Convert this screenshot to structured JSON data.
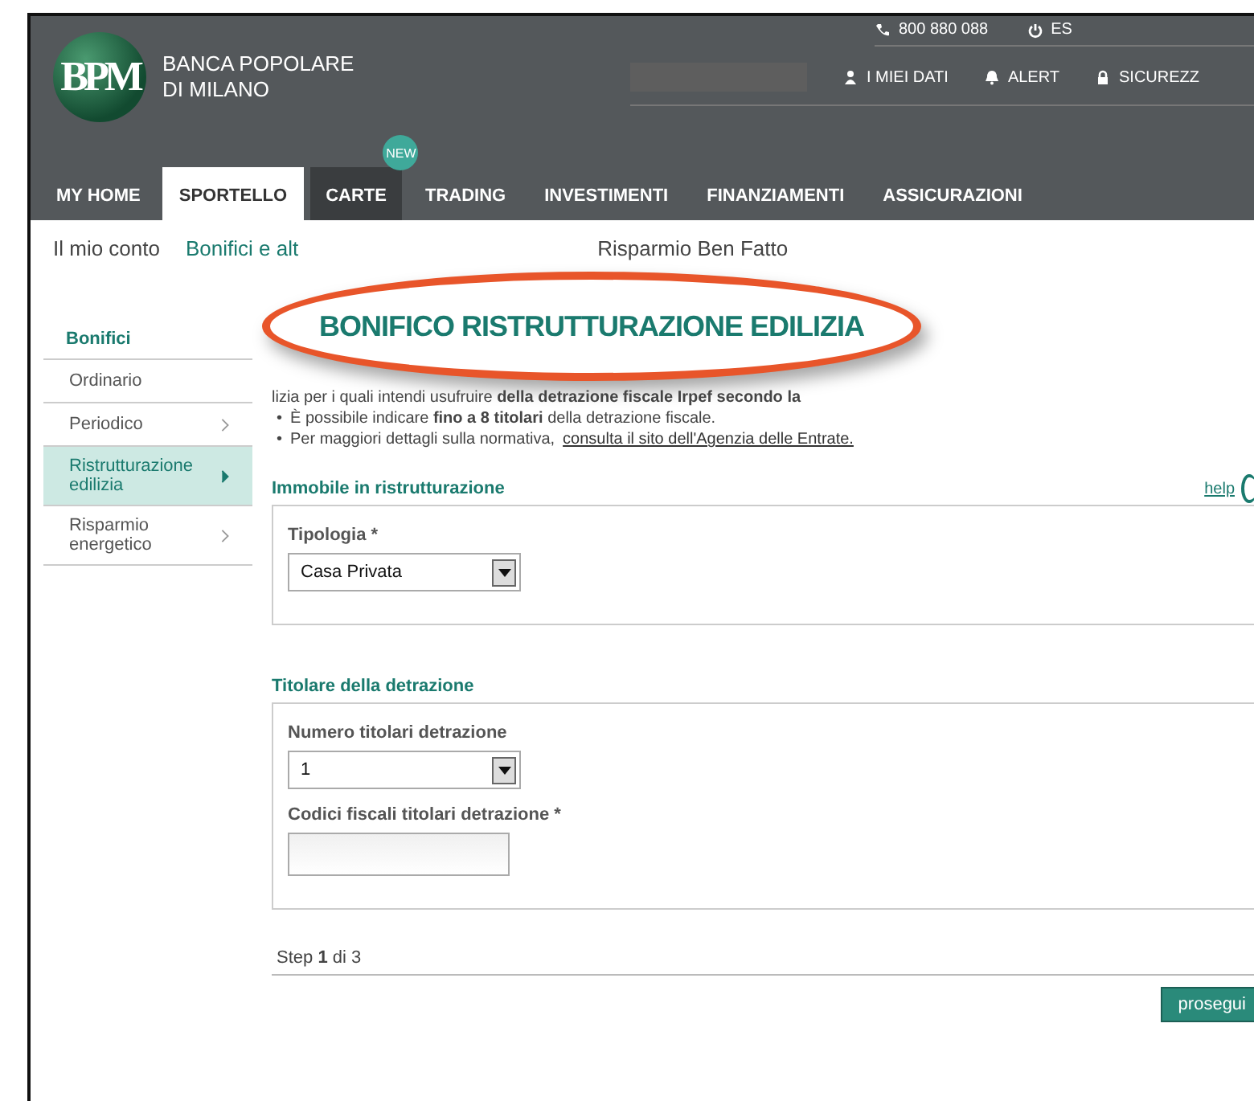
{
  "header": {
    "bank_name": [
      "BANCA POPOLARE",
      "DI MILANO"
    ],
    "logo_text": "BPM",
    "phone": "800 880 088",
    "exit": "ES",
    "utility_links": [
      {
        "label": "I MIEI DATI",
        "kind": "user"
      },
      {
        "label": "ALERT",
        "kind": "bell"
      },
      {
        "label": "SICUREZZ",
        "kind": "lock"
      }
    ]
  },
  "nav": [
    {
      "label": "MY HOME",
      "selected": false
    },
    {
      "label": "SPORTELLO",
      "selected": true
    },
    {
      "label": "CARTE",
      "selected": false,
      "badge": "NEW"
    },
    {
      "label": "TRADING",
      "selected": false
    },
    {
      "label": "INVESTIMENTI",
      "selected": false
    },
    {
      "label": "FINANZIAMENTI",
      "selected": false
    },
    {
      "label": "ASSICURAZIONI",
      "selected": false
    }
  ],
  "subnav": [
    {
      "label": "Il mio conto",
      "selected": false
    },
    {
      "label": "Bonifici e alt",
      "selected": true
    },
    {
      "label": "Risparmio Ben Fatto",
      "selected": false
    }
  ],
  "sidebar": {
    "title": "Bonifici",
    "items": [
      {
        "label": "Ordinario",
        "selected": false,
        "chevron": false
      },
      {
        "label": "Periodico",
        "selected": false,
        "chevron": true
      },
      {
        "label": "Ristrutturazione edilizia",
        "selected": true,
        "chevron": true
      },
      {
        "label": "Risparmio energetico",
        "selected": false,
        "chevron": true
      }
    ]
  },
  "callout": {
    "title": "BONIFICO RISTRUTTURAZIONE EDILIZIA"
  },
  "intro": {
    "first_line": "lizia per i quali intendi usufruire **della detrazione fiscale Irpef secondo la**",
    "bullets": [
      {
        "marker": "•",
        "text": "È possibile indicare **fino a 8 titolari** della detrazione fiscale."
      },
      {
        "marker": "•",
        "text": "Per maggiori dettagli sulla normativa,",
        "link": "consulta il sito dell'Agenzia delle Entrate."
      }
    ]
  },
  "sections": [
    {
      "title": "Immobile in ristrutturazione",
      "help": "help",
      "fields": [
        {
          "kind": "select",
          "label": "Tipologia *",
          "value": "Casa Privata"
        }
      ]
    },
    {
      "title": "Titolare della detrazione",
      "fields": [
        {
          "kind": "select",
          "label": "Numero titolari detrazione",
          "value": "1"
        },
        {
          "kind": "text",
          "label": "Codici fiscali titolari detrazione *"
        }
      ]
    }
  ],
  "step": "Step **1** di 3",
  "buttons": [
    "prosegui"
  ]
}
